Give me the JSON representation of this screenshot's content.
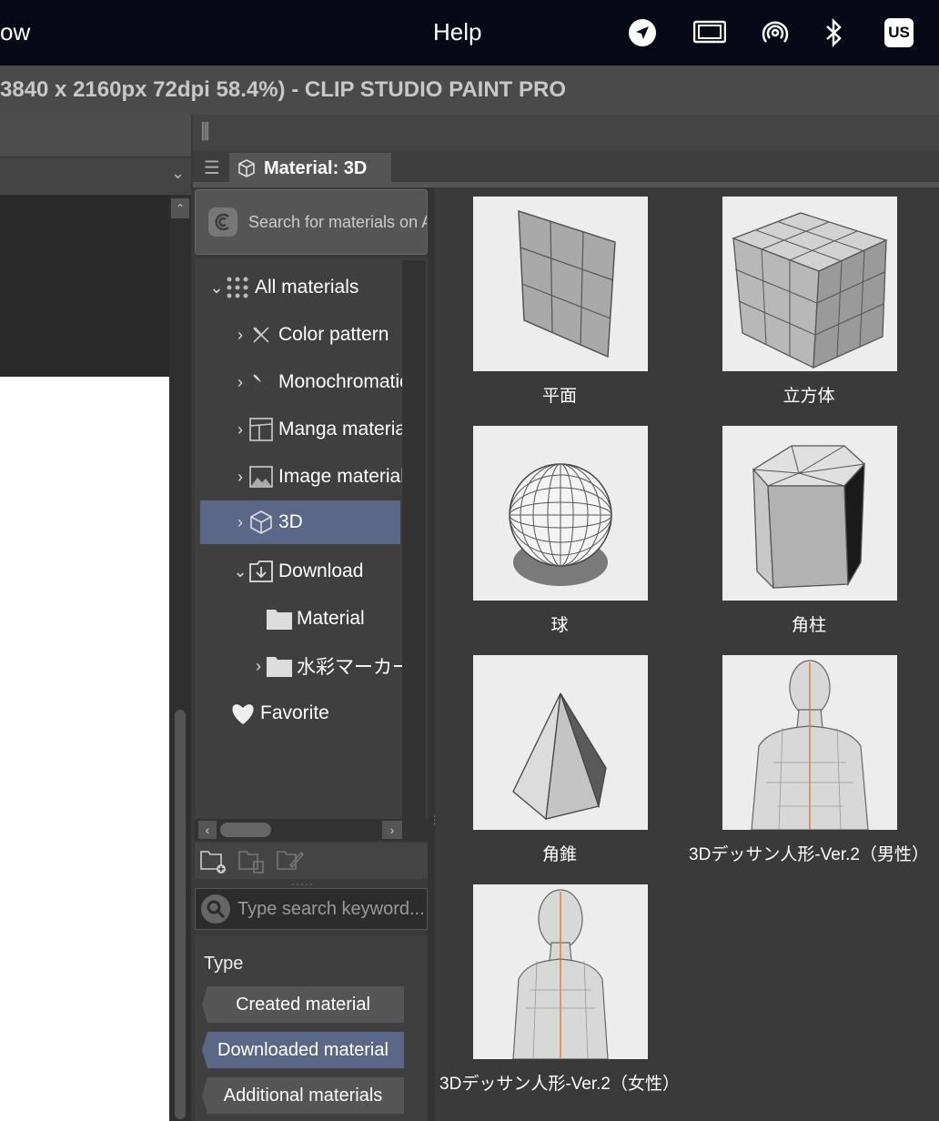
{
  "menubar": {
    "left_fragment": "ow",
    "help": "Help",
    "input_source": "US",
    "status_icons": [
      "location-arrow-icon",
      "screen-mirroring-icon",
      "airdrop-icon",
      "bluetooth-icon"
    ]
  },
  "window": {
    "title": "3840 x 2160px 72dpi 58.4%)  - CLIP STUDIO PAINT PRO"
  },
  "panel": {
    "tab_label": "Material: 3D",
    "search_assets_label": "Search for materials on ASSETS",
    "keyword_placeholder": "Type search keyword...",
    "tree": [
      {
        "label": "All materials",
        "arrow": "⌄",
        "icon": "grid-dots-icon"
      },
      {
        "label": "Color pattern",
        "arrow": "›",
        "icon": "color-pattern-icon"
      },
      {
        "label": "Monochromatic",
        "arrow": "›",
        "icon": "monochromatic-icon"
      },
      {
        "label": "Manga material",
        "arrow": "›",
        "icon": "manga-material-icon"
      },
      {
        "label": "Image material",
        "arrow": "›",
        "icon": "image-material-icon"
      },
      {
        "label": "3D",
        "arrow": "›",
        "icon": "cube-icon",
        "selected": true
      },
      {
        "label": "Download",
        "arrow": "⌄",
        "icon": "download-icon"
      },
      {
        "label": "Material",
        "arrow": "",
        "icon": "folder-icon"
      },
      {
        "label": "水彩マーカー",
        "arrow": "›",
        "icon": "folder-icon"
      },
      {
        "label": "Favorite",
        "arrow": "",
        "icon": "heart-icon"
      }
    ],
    "type_section": {
      "title": "Type",
      "buttons": [
        {
          "label": "Created material",
          "active": false
        },
        {
          "label": "Downloaded material",
          "active": true
        },
        {
          "label": "Additional materials",
          "active": false
        }
      ]
    },
    "materials": [
      {
        "name": "平面",
        "thumb": "plane"
      },
      {
        "name": "立方体",
        "thumb": "cube"
      },
      {
        "name": "球",
        "thumb": "sphere"
      },
      {
        "name": "角柱",
        "thumb": "prism"
      },
      {
        "name": "角錐",
        "thumb": "pyramid"
      },
      {
        "name": "3Dデッサン人形-Ver.2（男性）",
        "thumb": "male-figure"
      },
      {
        "name": "3Dデッサン人形-Ver.2（女性）",
        "thumb": "female-figure"
      }
    ]
  }
}
